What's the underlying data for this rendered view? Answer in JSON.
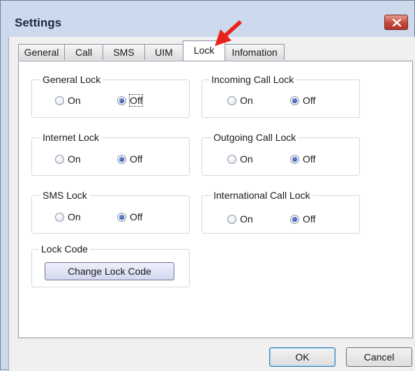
{
  "window": {
    "title": "Settings"
  },
  "colors": {
    "close_button": "#c4483a",
    "annotation_arrow": "#e8231e"
  },
  "icons": {
    "close": "close-icon",
    "annotation": "red-arrow-icon"
  },
  "tabs": [
    {
      "label": "General",
      "selected": false
    },
    {
      "label": "Call",
      "selected": false
    },
    {
      "label": "SMS",
      "selected": false
    },
    {
      "label": "UIM",
      "selected": false
    },
    {
      "label": "Lock",
      "selected": true
    },
    {
      "label": "Infomation",
      "selected": false
    }
  ],
  "groups": {
    "general_lock": {
      "title": "General Lock",
      "on_label": "On",
      "off_label": "Off",
      "selected": "Off"
    },
    "incoming_call_lock": {
      "title": "Incoming Call Lock",
      "on_label": "On",
      "off_label": "Off",
      "selected": "Off"
    },
    "internet_lock": {
      "title": "Internet Lock",
      "on_label": "On",
      "off_label": "Off",
      "selected": "Off"
    },
    "outgoing_call_lock": {
      "title": "Outgoing Call Lock",
      "on_label": "On",
      "off_label": "Off",
      "selected": "Off"
    },
    "sms_lock": {
      "title": "SMS Lock",
      "on_label": "On",
      "off_label": "Off",
      "selected": "Off"
    },
    "international_call_lock": {
      "title": "International Call Lock",
      "on_label": "On",
      "off_label": "Off",
      "selected": "Off"
    },
    "lock_code": {
      "title": "Lock Code",
      "button_label": "Change Lock Code"
    }
  },
  "buttons": {
    "ok": "OK",
    "cancel": "Cancel"
  }
}
